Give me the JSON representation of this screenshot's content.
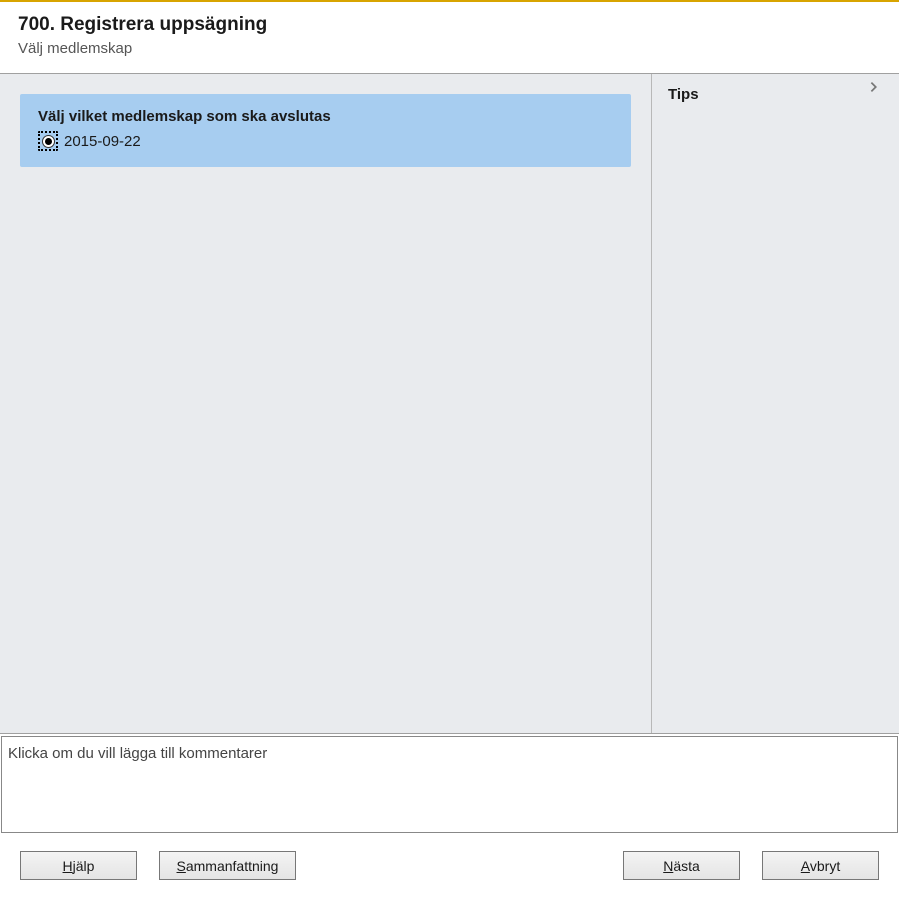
{
  "header": {
    "title": "700. Registrera uppsägning",
    "subtitle": "Välj medlemskap"
  },
  "selection": {
    "heading": "Välj vilket medlemskap som ska avslutas",
    "option_date": "2015-09-22"
  },
  "tips": {
    "title": "Tips"
  },
  "comment": {
    "placeholder": "Klicka om du vill lägga till kommentarer"
  },
  "buttons": {
    "help_first": "H",
    "help_rest": "jälp",
    "summary_first": "S",
    "summary_rest": "ammanfattning",
    "next_first": "N",
    "next_rest": "ästa",
    "cancel_first": "A",
    "cancel_rest": "vbryt"
  }
}
